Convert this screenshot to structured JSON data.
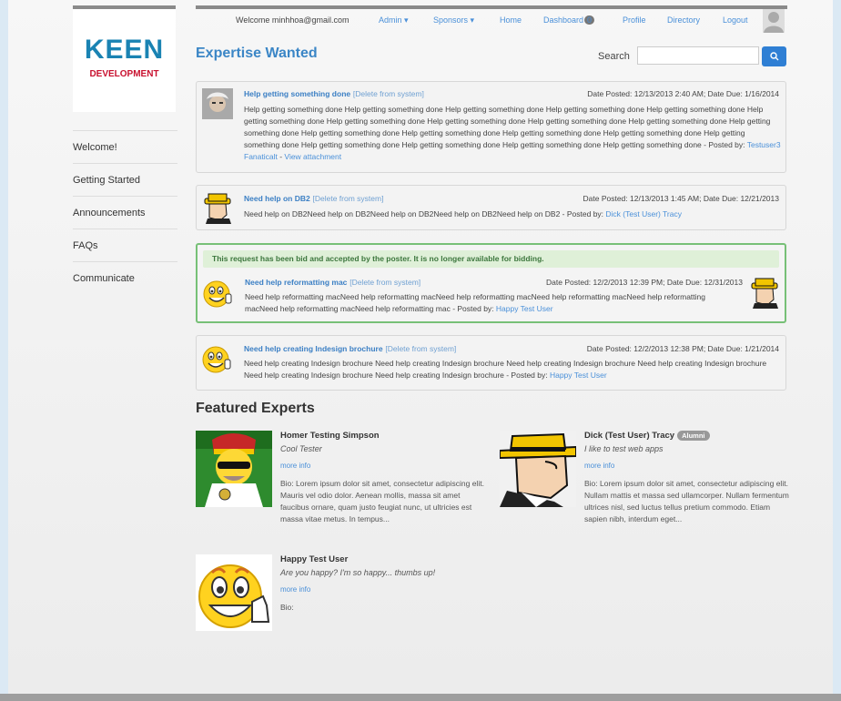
{
  "brand": {
    "line1": "KEEN",
    "line2": "DEVELOPMENT"
  },
  "sidebar": {
    "items": [
      {
        "label": "Welcome!"
      },
      {
        "label": "Getting Started"
      },
      {
        "label": "Announcements"
      },
      {
        "label": "FAQs"
      },
      {
        "label": "Communicate"
      }
    ]
  },
  "topnav": {
    "welcome": "Welcome minhhoa@gmail.com",
    "admin": "Admin ▾",
    "sponsors": "Sponsors ▾",
    "home": "Home",
    "dashboard": "Dashboard",
    "dashboard_count": "0",
    "profile": "Profile",
    "directory": "Directory",
    "logout": "Logout"
  },
  "page": {
    "title": "Expertise Wanted",
    "search_label": "Search",
    "search_placeholder": "",
    "search_icon": "search-icon"
  },
  "requests": [
    {
      "title": "Help getting something done",
      "delete_link": "[Delete from system]",
      "meta": "Date Posted: 12/13/2013 2:40 AM; Date Due: 1/16/2014",
      "body": "Help getting something done Help getting something done Help getting something done Help getting something done Help getting something done Help getting something done Help getting something done Help getting something done Help getting something done Help getting something done Help getting something done Help getting something done Help getting something done Help getting something done Help getting something done Help getting something done Help getting something done Help getting something done Help getting something done Help getting something done -",
      "posted_by_prefix": " Posted by: ",
      "user": "Testuser3 Fanaticalt",
      "attachment": "View attachment"
    },
    {
      "title": "Need help on DB2",
      "delete_link": "[Delete from system]",
      "meta": "Date Posted: 12/13/2013 1:45 AM; Date Due: 12/21/2013",
      "body": "Need help on DB2Need help on DB2Need help on DB2Need help on DB2Need help on DB2 - Posted by: ",
      "user": "Dick (Test User) Tracy"
    },
    {
      "alert": "This request has been bid and accepted by the poster. It is no longer available for bidding.",
      "title": "Need help reformatting mac",
      "delete_link": "[Delete from system]",
      "meta": "Date Posted: 12/2/2013 12:39 PM; Date Due: 12/31/2013",
      "body": "Need help reformatting macNeed help reformatting macNeed help reformatting macNeed help reformatting macNeed help reformatting macNeed help reformatting macNeed help reformatting mac - Posted by: ",
      "user": "Happy Test User"
    },
    {
      "title": "Need help creating Indesign brochure",
      "delete_link": "[Delete from system]",
      "meta": "Date Posted: 12/2/2013 12:38 PM; Date Due: 1/21/2014",
      "body": "Need help creating Indesign brochure Need help creating Indesign brochure Need help creating Indesign brochure Need help creating Indesign brochure Need help creating Indesign brochure Need help creating Indesign brochure - Posted by: ",
      "user": "Happy Test User"
    }
  ],
  "featured": {
    "title": "Featured Experts",
    "experts": [
      {
        "name": "Homer Testing Simpson",
        "tagline": "Cool Tester",
        "more": "more info",
        "bio": "Bio: Lorem ipsum dolor sit amet, consectetur adipiscing elit. Mauris vel odio dolor. Aenean mollis, massa sit amet faucibus ornare, quam justo feugiat nunc, ut ultricies est massa vitae metus. In tempus..."
      },
      {
        "name": "Dick (Test User) Tracy",
        "badge": "Alumni",
        "tagline": "I like to test web apps",
        "more": "more info",
        "bio": "Bio: Lorem ipsum dolor sit amet, consectetur adipiscing elit. Nullam mattis et massa sed ullamcorper. Nullam fermentum ultrices nisl, sed luctus tellus pretium commodo. Etiam sapien nibh, interdum eget..."
      },
      {
        "name": "Happy Test User",
        "tagline": "Are you happy? I'm so happy... thumbs up!",
        "more": "more info",
        "bio": "Bio:"
      }
    ]
  }
}
